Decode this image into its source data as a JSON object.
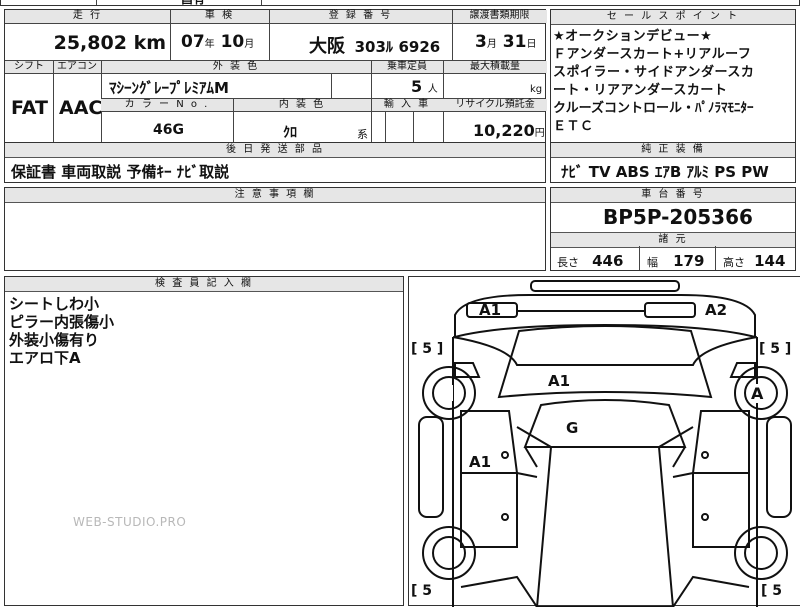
{
  "top_strip": {
    "partial_text": "昌有"
  },
  "main": {
    "headers": {
      "mileage": "走 行",
      "inspection": "車 検",
      "registration": "登 録 番 号",
      "transfer_deadline": "譲渡書類期限",
      "shift": "シフト",
      "aircon": "エアコン",
      "exterior_color": "外 装 色",
      "capacity": "乗車定員",
      "max_load": "最大積載量",
      "color_no": "カ ラ ー N o .",
      "interior_color": "内 装 色",
      "import": "輸 入 車",
      "recycle": "リサイクル預託金",
      "aftermarket": "後 日 発 送 部 品"
    },
    "mileage_value": "25,802",
    "mileage_unit": "km",
    "inspection_year": "07",
    "inspection_year_unit": "年",
    "inspection_month": "10",
    "inspection_month_unit": "月",
    "registration_region": "大阪",
    "registration_class": "303",
    "registration_kana": "ﾙ",
    "registration_number": "6926",
    "transfer_month": "3",
    "transfer_month_unit": "月",
    "transfer_day": "31",
    "transfer_day_unit": "日",
    "shift_value": "FAT",
    "aircon_value": "AAC",
    "exterior_color_value": "ﾏｼｰﾝｸﾞﾚｰﾌﾟﾚﾐｱﾑM",
    "capacity_value": "5",
    "capacity_unit": "人",
    "max_load_unit": "kg",
    "color_no_value": "46G",
    "interior_color_value": "ｸﾛ",
    "interior_color_suffix": "系",
    "recycle_value": "10,220",
    "recycle_unit": "円",
    "aftermarket_value": "保証書 車両取説 予備ｷｰ ﾅﾋﾞ取説"
  },
  "sales_points": {
    "header": "セ ー ル ス ポ イ ン ト",
    "lines": [
      "★オークションデビュー★",
      "Ｆアンダースカート+リアルーフ",
      "スポイラー・サイドアンダースカ",
      "ート・リアアンダースカート",
      "クルーズコントロール・ﾊﾟﾉﾗﾏﾓﾆﾀｰ",
      "ＥＴＣ"
    ]
  },
  "genuine_equipment": {
    "header": "純 正 装 備",
    "value": "ﾅﾋﾞ TV ABS ｴｱB ｱﾙﾐ PS PW"
  },
  "notes": {
    "header": "注 意 事 項 欄",
    "value": ""
  },
  "chassis": {
    "header": "車 台 番 号",
    "value": "BP5P-205366"
  },
  "specs": {
    "header": "諸 元",
    "length_label": "長さ",
    "length_value": "446",
    "width_label": "幅",
    "width_value": "179",
    "height_label": "高さ",
    "height_value": "144"
  },
  "inspector": {
    "header": "検 査 員 記 入 欄",
    "lines": [
      "シートしわ小",
      "ピラー内張傷小",
      "外装小傷有り",
      "エアロ下A"
    ]
  },
  "watermark": "WEB-STUDIO.PRO",
  "diagram": {
    "marks": {
      "front_left": "A1",
      "front_right": "A2",
      "hood": "A1",
      "windshield": "G",
      "left_door": "A1",
      "right_wheel": "A"
    },
    "tire_labels": {
      "front_left": "[ 5 ]",
      "front_right": "[ 5 ]",
      "rear_left": "[ 5",
      "rear_right": "[ 5"
    }
  }
}
